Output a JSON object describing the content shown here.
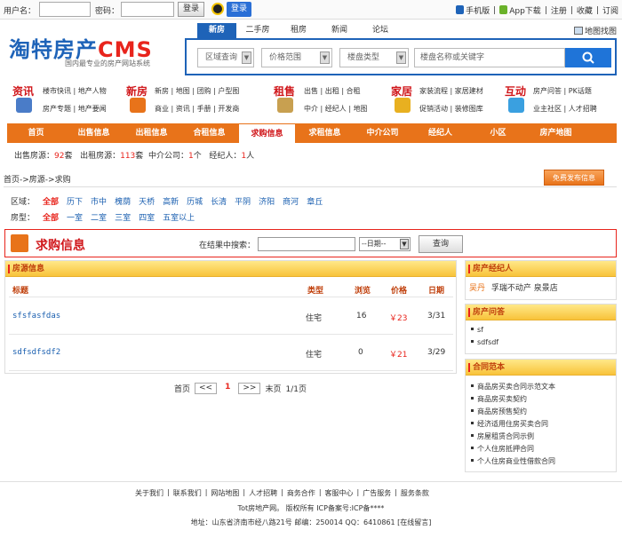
{
  "topbar": {
    "username_label": "用户名：",
    "password_label": "密码：",
    "login_label": "登录",
    "qq_login_label": "登录",
    "links": [
      "手机版",
      "App下载",
      "注册",
      "收藏",
      "订阅"
    ]
  },
  "logo": {
    "text": "淘特房产",
    "cms": "CMS",
    "slogan": "国内最专业的房产网站系统"
  },
  "search": {
    "tabs": [
      "新房",
      "二手房",
      "租房",
      "新闻",
      "论坛"
    ],
    "active_tab": "新房",
    "map_link": "地图找图",
    "selects": [
      "区域查询",
      "价格范围",
      "楼盘类型"
    ],
    "keyword_placeholder": "楼盘名称或关键字"
  },
  "categories": [
    {
      "title": "资讯",
      "row1": [
        "楼市快讯",
        "地产人物"
      ],
      "row2": [
        "房产专题",
        "地产要闻"
      ],
      "color": "#4a7cc8"
    },
    {
      "title": "新房",
      "row1": [
        "新房",
        "地图",
        "团购",
        "户型图"
      ],
      "row2": [
        "商业",
        "资讯",
        "手册",
        "开发商"
      ],
      "color": "#e8731a"
    },
    {
      "title": "租售",
      "row1": [
        "出售",
        "出租",
        "合租"
      ],
      "row2": [
        "中介",
        "经纪人",
        "地图"
      ],
      "color": "#c8a050"
    },
    {
      "title": "家居",
      "row1": [
        "家装流程",
        "家居建材"
      ],
      "row2": [
        "促销活动",
        "装修图库"
      ],
      "color": "#e8b020"
    },
    {
      "title": "互动",
      "row1": [
        "房产问答",
        "PK话题"
      ],
      "row2": [
        "业主社区",
        "人才招聘"
      ],
      "color": "#3aa0e0"
    }
  ],
  "nav": [
    "首页",
    "出售信息",
    "出租信息",
    "合租信息",
    "求购信息",
    "求租信息",
    "中介公司",
    "经纪人",
    "小区",
    "房产地图"
  ],
  "nav_active": "求购信息",
  "stats": {
    "sale_label": "出售房源：",
    "sale_count": "92",
    "sale_unit": "套",
    "rent_label": "出租房源：",
    "rent_count": "113",
    "rent_unit": "套",
    "agency_label": "中介公司：",
    "agency_count": "1",
    "agency_unit": "个",
    "broker_label": "经纪人：",
    "broker_count": "1",
    "broker_unit": "人"
  },
  "breadcrumb": "首页->房源->求购",
  "free_publish": "免费发布信息",
  "filters": {
    "area_label": "区域：",
    "areas": [
      "全部",
      "历下",
      "市中",
      "槐荫",
      "天桥",
      "高新",
      "历城",
      "长清",
      "平阴",
      "济阳",
      "商河",
      "章丘"
    ],
    "type_label": "房型：",
    "types": [
      "全部",
      "一室",
      "二室",
      "三室",
      "四室",
      "五室以上"
    ]
  },
  "qiugou": {
    "title": "求购信息",
    "search_label": "在结果中搜索：",
    "date_select": "--日期--",
    "query_btn": "查询"
  },
  "listing": {
    "panel_title": "房源信息",
    "columns": [
      "标题",
      "类型",
      "浏览",
      "价格",
      "日期"
    ],
    "rows": [
      {
        "title": "sfsfasfdas",
        "type": "住宅",
        "views": "16",
        "price": "￥23",
        "date": "3/31"
      },
      {
        "title": "sdfsdfsdf2",
        "type": "住宅",
        "views": "0",
        "price": "￥21",
        "date": "3/29"
      }
    ]
  },
  "pager": {
    "first": "首页",
    "prev": "<<",
    "current": "1",
    "next": ">>",
    "last": "末页",
    "info": "1/1页"
  },
  "sidebar": {
    "broker_title": "房产经纪人",
    "broker_name": "吴丹",
    "broker_company": "孚瑞不动产 泉景店",
    "qa_title": "房产问答",
    "qa_items": [
      "sf",
      "sdfsdf"
    ],
    "contract_title": "合同范本",
    "contracts": [
      "商品房买卖合同示范文本",
      "商品房买卖契约",
      "商品房预售契约",
      "经济适用住房买卖合同",
      "房屋租赁合同示例",
      "个人住房抵押合同",
      "个人住房商业性借款合同"
    ]
  },
  "footer": {
    "links": [
      "关于我们",
      "联系我们",
      "网站地图",
      "人才招聘",
      "商务合作",
      "客服中心",
      "广告服务",
      "服务条款"
    ],
    "copyright": "Tot房地产网。 版权所有 ICP备案号:ICP备****",
    "address": "地址：山东省济南市经八路21号 邮编：250014 QQ：6410861 [在线留言]"
  }
}
